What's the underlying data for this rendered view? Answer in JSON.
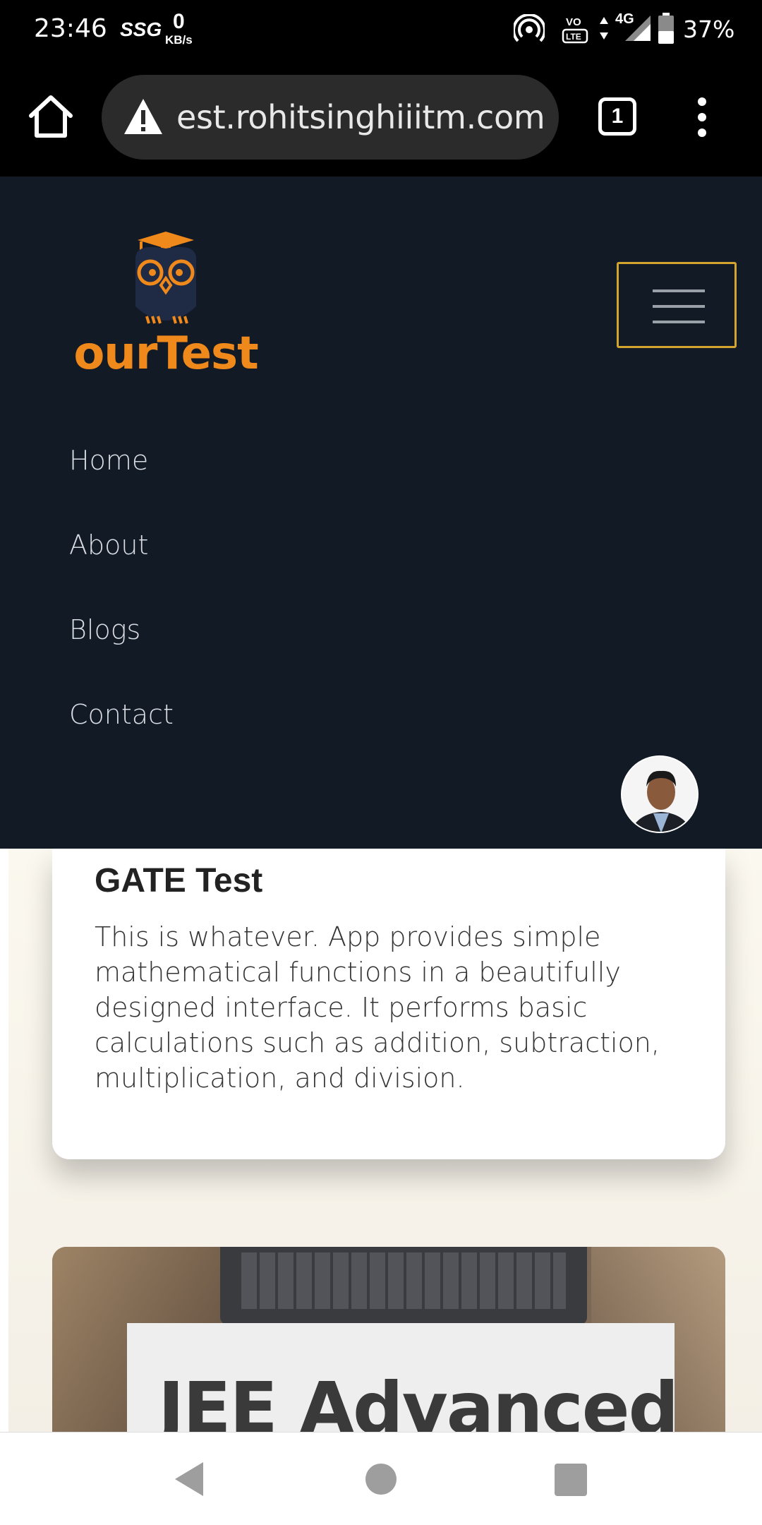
{
  "status_bar": {
    "time": "23:46",
    "carrier_badge": "SSG",
    "speed_value": "0",
    "speed_unit": "KB/s",
    "network": "4G",
    "volte": "VoLTE",
    "battery_percent": "37%"
  },
  "browser": {
    "url": "est.rohitsinghiiitm.com",
    "tab_count": "1",
    "security_icon": "warning-triangle-icon"
  },
  "site": {
    "logo_text": "ourTest",
    "logo_color": "#f0891b",
    "nav_items": [
      {
        "label": "Home"
      },
      {
        "label": "About"
      },
      {
        "label": "Blogs"
      },
      {
        "label": "Contact"
      }
    ]
  },
  "cards": [
    {
      "title": "GATE Test",
      "description": "This is whatever. App provides simple mathematical functions in a beautifully designed interface. It performs basic calculations such as addition, subtraction, multiplication, and division."
    },
    {
      "image_text": "JEE Advanced"
    }
  ]
}
